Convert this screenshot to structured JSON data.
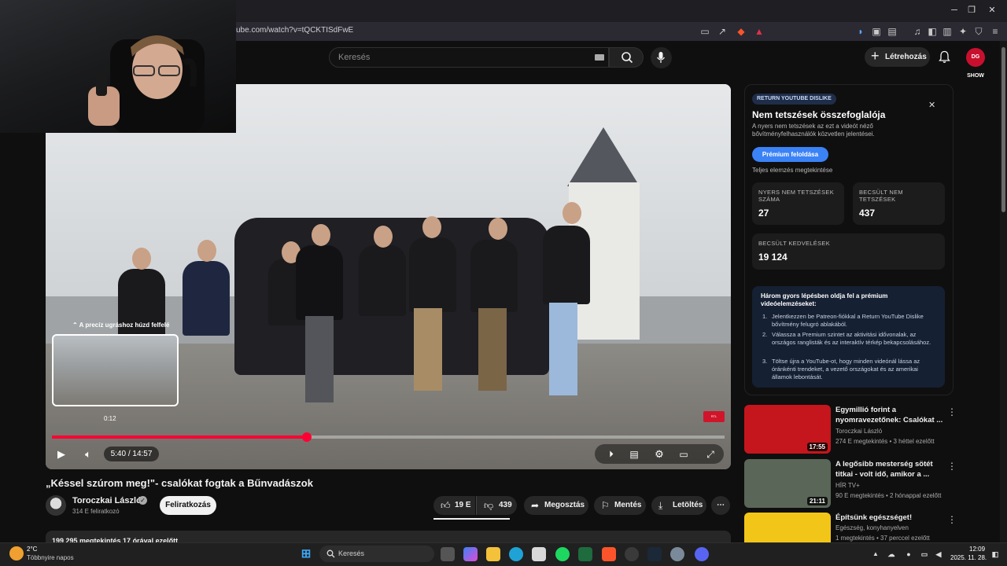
{
  "browser": {
    "url": "ube.com/watch?v=tQCKTISdFwE",
    "window_controls": [
      "minimize-icon",
      "restore-icon",
      "close-icon"
    ]
  },
  "header": {
    "search_placeholder": "Keresés",
    "create_label": "Létrehozás",
    "avatar_text": "DG SHOW"
  },
  "player": {
    "preview_hint": "⌃ A precíz ugráshoz húzd felfelé",
    "preview_time": "0:12",
    "time_display": "5:40 / 14:57",
    "progress": 0.379,
    "badge_text": "RTL"
  },
  "video": {
    "title": "„Késsel szúrom meg!\"- csalókat fogtak a Bűnvadászok",
    "channel": "Toroczkai László",
    "subscribers": "314 E feliratkozó",
    "subscribe_label": "Feliratkozás",
    "likes": "19 E",
    "dislikes": "439",
    "share_label": "Megosztás",
    "save_label": "Mentés",
    "download_label": "Letöltés",
    "description_preview": "199 295 megtekintés  17 órával ezelőtt"
  },
  "ryd": {
    "badge": "RETURN YOUTUBE DISLIKE",
    "title": "Nem tetszések összefoglalója",
    "description": "A nyers nem tetszések az ezt a videót néző bővítményfelhasználók közvetlen jelentései.",
    "premium_button": "Prémium feloldása",
    "full_analysis": "Teljes elemzés megtekintése",
    "raw_label": "NYERS NEM TETSZÉSEK SZÁMA",
    "raw_value": "27",
    "estimated_label": "BECSÜLT NEM TETSZÉSEK",
    "estimated_value": "437",
    "likes_label": "BECSÜLT KEDVELÉSEK",
    "likes_value": "19 124",
    "steps_title": "Három gyors lépésben oldja fel a prémium videóelemzéseket:",
    "steps": [
      "Jelentkezzen be Patreon-fiókkal a Return YouTube Dislike bővítmény felugró ablakából.",
      "Válassza a Premium szintet az aktivitási idővonalak, az országos ranglisták és az interaktív térkép bekapcsolásához.",
      "Töltse újra a YouTube-ot, hogy minden videónál lássa az óránkénti trendeket, a vezető országokat és az amerikai államok lebontását."
    ]
  },
  "recommendations": [
    {
      "title": "Egymillió forint a nyomravezetőnek: Csalókat ...",
      "channel": "Toroczkai László",
      "meta": "274 E megtekintés • 3 héttel ezelőtt",
      "duration": "17:55",
      "color": "#c4161c"
    },
    {
      "title": "A legősibb mesterség sötét titkai - volt idő, amikor a ...",
      "channel": "HÍR TV+",
      "meta": "90 E megtekintés • 2 hónappal ezelőtt",
      "duration": "21:11",
      "color": "#5a6658"
    },
    {
      "title": "Építsünk egészséget!",
      "channel": "Egészség, konyhanyelven",
      "meta": "1 megtekintés • 37 perccel ezelőtt",
      "duration": "",
      "color": "#f2c618"
    }
  ],
  "taskbar": {
    "temperature": "2°C",
    "weather_desc": "Többnyire napos",
    "search_label": "Keresés",
    "time": "12:09",
    "date": "2025. 11. 28."
  }
}
